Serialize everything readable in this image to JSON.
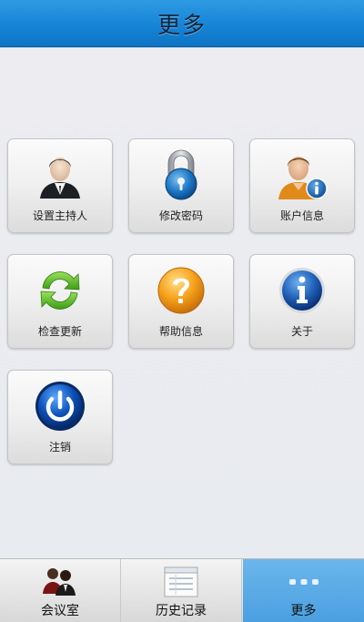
{
  "header": {
    "title": "更多"
  },
  "tiles": [
    {
      "label": "设置主持人",
      "icon": "host-person-icon"
    },
    {
      "label": "修改密码",
      "icon": "padlock-icon"
    },
    {
      "label": "账户信息",
      "icon": "account-info-icon"
    },
    {
      "label": "检查更新",
      "icon": "refresh-icon"
    },
    {
      "label": "帮助信息",
      "icon": "question-icon"
    },
    {
      "label": "关于",
      "icon": "info-icon"
    },
    {
      "label": "注销",
      "icon": "power-icon"
    }
  ],
  "tabbar": {
    "active": "更多",
    "tabs": [
      {
        "label": "会议室",
        "icon": "meeting-people-icon"
      },
      {
        "label": "历史记录",
        "icon": "history-list-icon"
      },
      {
        "label": "更多",
        "icon": "more-dots-icon"
      }
    ]
  },
  "colors": {
    "header": "#1684d6",
    "active_tab": "#5aa8e6",
    "background": "#e9ecf1"
  }
}
